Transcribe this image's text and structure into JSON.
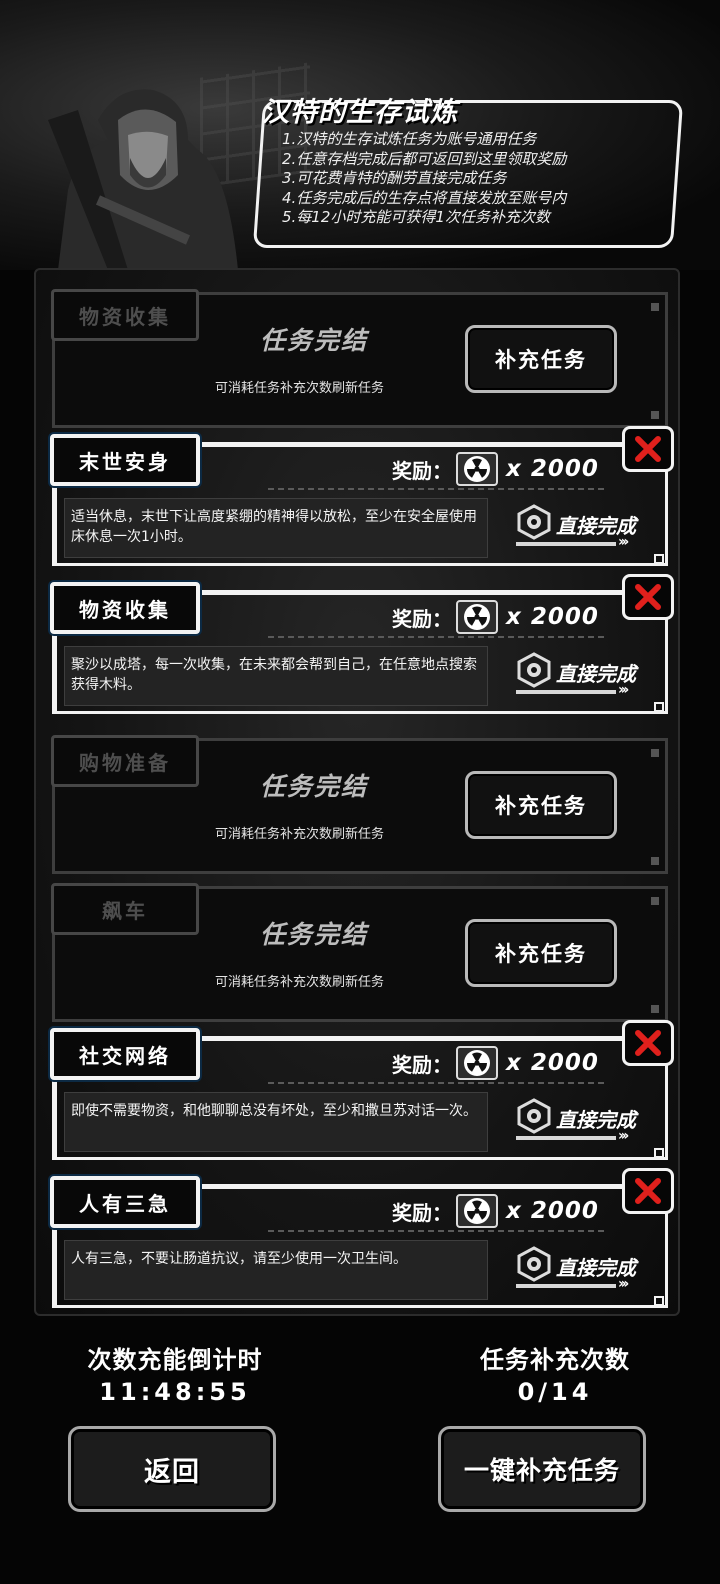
{
  "header": {
    "title": "汉特的生存试炼",
    "rules": [
      "1.汉特的生存试炼任务为账号通用任务",
      "2.任意存档完成后都可返回到这里领取奖励",
      "3.可花费肯特的酬劳直接完成任务",
      "4.任务完成后的生存点将直接发放至账号内",
      "5.每12小时充能可获得1次任务补充次数"
    ]
  },
  "tasks": [
    {
      "tag": "物资收集",
      "status": "任务完结",
      "sub": "可消耗任务补充次数刷新任务",
      "button": "补充任务"
    },
    {
      "tag": "末世安身",
      "reward_label": "奖励：",
      "reward_icon": "radiation-icon",
      "multiplier": "x 2000",
      "desc": "适当休息，末世下让高度紧绷的精神得以放松，至少在安全屋使用床休息一次1小时。",
      "direct": "直接完成",
      "arrows": "›››"
    },
    {
      "tag": "物资收集",
      "reward_label": "奖励：",
      "reward_icon": "radiation-icon",
      "multiplier": "x 2000",
      "desc": "聚沙以成塔，每一次收集，在未来都会帮到自己，在任意地点搜索获得木料。",
      "direct": "直接完成",
      "arrows": "›››"
    },
    {
      "tag": "购物准备",
      "status": "任务完结",
      "sub": "可消耗任务补充次数刷新任务",
      "button": "补充任务"
    },
    {
      "tag": "飙车",
      "status": "任务完结",
      "sub": "可消耗任务补充次数刷新任务",
      "button": "补充任务"
    },
    {
      "tag": "社交网络",
      "reward_label": "奖励：",
      "reward_icon": "radiation-icon",
      "multiplier": "x 2000",
      "desc": "即使不需要物资，和他聊聊总没有坏处，至少和撒旦苏对话一次。",
      "direct": "直接完成",
      "arrows": "›››"
    },
    {
      "tag": "人有三急",
      "reward_label": "奖励：",
      "reward_icon": "radiation-icon",
      "multiplier": "x 2000",
      "desc": "人有三急，不要让肠道抗议，请至少使用一次卫生间。",
      "direct": "直接完成",
      "arrows": "›››"
    }
  ],
  "footer": {
    "countdown_label": "次数充能倒计时",
    "countdown_value": "11:48:55",
    "refills_label": "任务补充次数",
    "refills_value": "0/14",
    "back_button": "返回",
    "refill_all_button": "一键补充任务"
  },
  "colors": {
    "background": "#050505",
    "panel": "#161616",
    "accent_close": "#e0201c",
    "frame": "#f3f3f3"
  }
}
